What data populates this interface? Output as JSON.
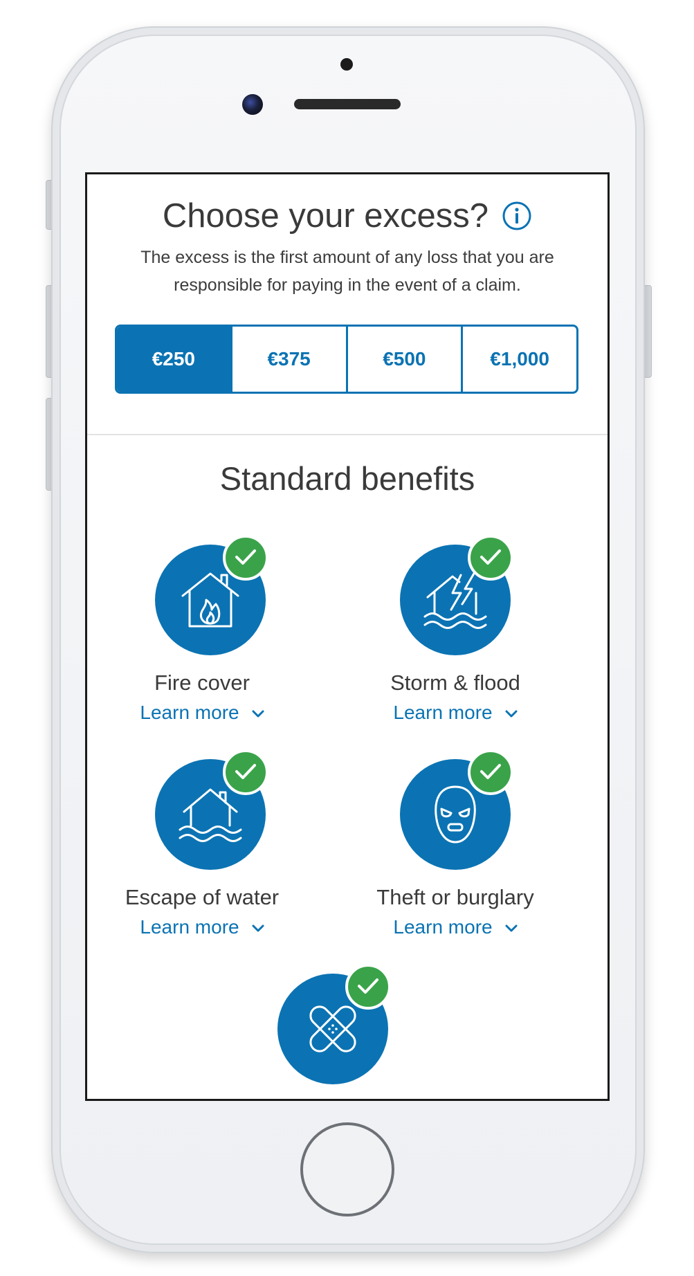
{
  "excess": {
    "title": "Choose your excess?",
    "description": "The excess is the first amount of any loss that you are responsible for paying in the event of a claim.",
    "options": [
      "€250",
      "€375",
      "€500",
      "€1,000"
    ],
    "selected": "€250"
  },
  "benefits": {
    "title": "Standard benefits",
    "items": [
      {
        "label": "Fire cover",
        "link": "Learn more",
        "icon": "house-fire-icon"
      },
      {
        "label": "Storm & flood",
        "link": "Learn more",
        "icon": "storm-flood-icon"
      },
      {
        "label": "Escape of water",
        "link": "Learn more",
        "icon": "house-water-icon"
      },
      {
        "label": "Theft or burglary",
        "link": "Learn more",
        "icon": "burglar-mask-icon"
      },
      {
        "icon": "plaster-bandage-icon"
      }
    ]
  },
  "colors": {
    "brand": "#0b73b3",
    "check": "#3aa34a",
    "text": "#3a3a3a"
  }
}
